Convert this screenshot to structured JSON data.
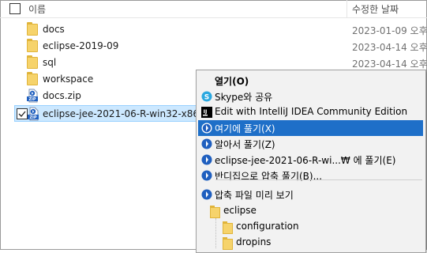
{
  "header": {
    "name_label": "이름",
    "date_label": "수정한 날짜"
  },
  "files": [
    {
      "name": "docs",
      "date": "2023-01-09 오후",
      "icon": "folder-icon"
    },
    {
      "name": "eclipse-2019-09",
      "date": "2023-04-14 오후",
      "icon": "folder-icon"
    },
    {
      "name": "sql",
      "date": "2023-04-14 오후",
      "icon": "folder-icon"
    },
    {
      "name": "workspace",
      "date": "",
      "icon": "folder-icon"
    },
    {
      "name": "docs.zip",
      "date": "",
      "icon": "zip-icon"
    },
    {
      "name": "eclipse-jee-2021-06-R-win32-x86_6",
      "date": "",
      "icon": "zip-icon",
      "selected": true
    }
  ],
  "context_menu": {
    "items": [
      {
        "label": "열기(O)",
        "icon": "",
        "bold": true
      },
      {
        "label": "Skype와 공유",
        "icon": "skype-icon"
      },
      {
        "label": "Edit with IntelliJ IDEA Community Edition",
        "icon": "intellij-icon"
      },
      {
        "label": "여기에 풀기(X)",
        "icon": "bandizip-icon",
        "highlighted": true
      },
      {
        "label": "알아서 풀기(Z)",
        "icon": "bandizip-icon"
      },
      {
        "label": "eclipse-jee-2021-06-R-wi...₩ 에 풀기(E)",
        "icon": "bandizip-icon"
      },
      {
        "label": "반디집으로 압축 풀기(B)...",
        "icon": "bandizip-icon"
      }
    ],
    "preview": {
      "label": "압축 파일 미리 보기",
      "icon": "bandizip-icon",
      "tree": [
        {
          "label": "eclipse",
          "level": 0
        },
        {
          "label": "configuration",
          "level": 1
        },
        {
          "label": "dropins",
          "level": 1
        }
      ]
    }
  },
  "colors": {
    "selection_bg": "#cce8ff",
    "menu_highlight": "#1e6fc8",
    "bandizip_blue": "#1f5fbf",
    "folder_yellow": "#f6d36b"
  }
}
